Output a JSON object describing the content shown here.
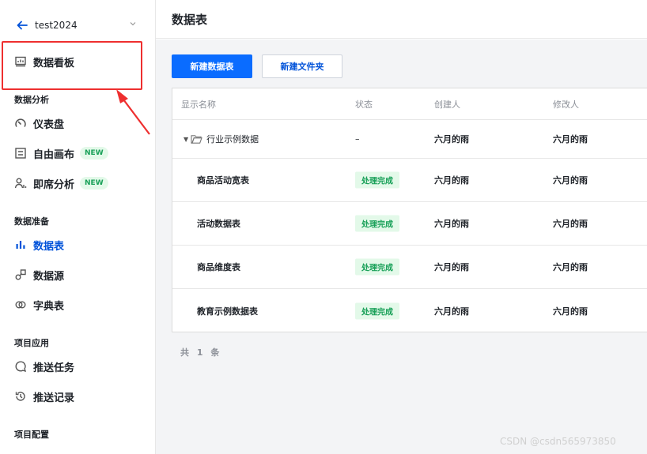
{
  "project": {
    "name": "test2024"
  },
  "sidebar": {
    "dashboard": {
      "label": "数据看板"
    },
    "groups": {
      "analysis": "数据分析",
      "prep": "数据准备",
      "app": "项目应用",
      "config": "项目配置"
    },
    "items": {
      "instrument": "仪表盘",
      "canvas": "自由画布",
      "adhoc": "即席分析",
      "datatable": "数据表",
      "datasource": "数据源",
      "dictionary": "字典表",
      "pushtask": "推送任务",
      "pushlog": "推送记录"
    },
    "badge_new": "NEW"
  },
  "header": {
    "title": "数据表"
  },
  "toolbar": {
    "new_table": "新建数据表",
    "new_folder": "新建文件夹"
  },
  "table": {
    "columns": [
      "显示名称",
      "状态",
      "创建人",
      "修改人"
    ],
    "folder": {
      "name": "行业示例数据",
      "status": "–",
      "creator": "六月的雨",
      "modifier": "六月的雨"
    },
    "rows": [
      {
        "name": "商品活动宽表",
        "status": "处理完成",
        "creator": "六月的雨",
        "modifier": "六月的雨"
      },
      {
        "name": "活动数据表",
        "status": "处理完成",
        "creator": "六月的雨",
        "modifier": "六月的雨"
      },
      {
        "name": "商品维度表",
        "status": "处理完成",
        "creator": "六月的雨",
        "modifier": "六月的雨"
      },
      {
        "name": "教育示例数据表",
        "status": "处理完成",
        "creator": "六月的雨",
        "modifier": "六月的雨"
      }
    ]
  },
  "footer": {
    "total": "共 1 条"
  },
  "watermark": "CSDN @csdn565973850",
  "colors": {
    "accent": "#0052d9",
    "primary_button": "#0a6cff",
    "success": "#18a058",
    "highlight": "#ee2f2f"
  }
}
